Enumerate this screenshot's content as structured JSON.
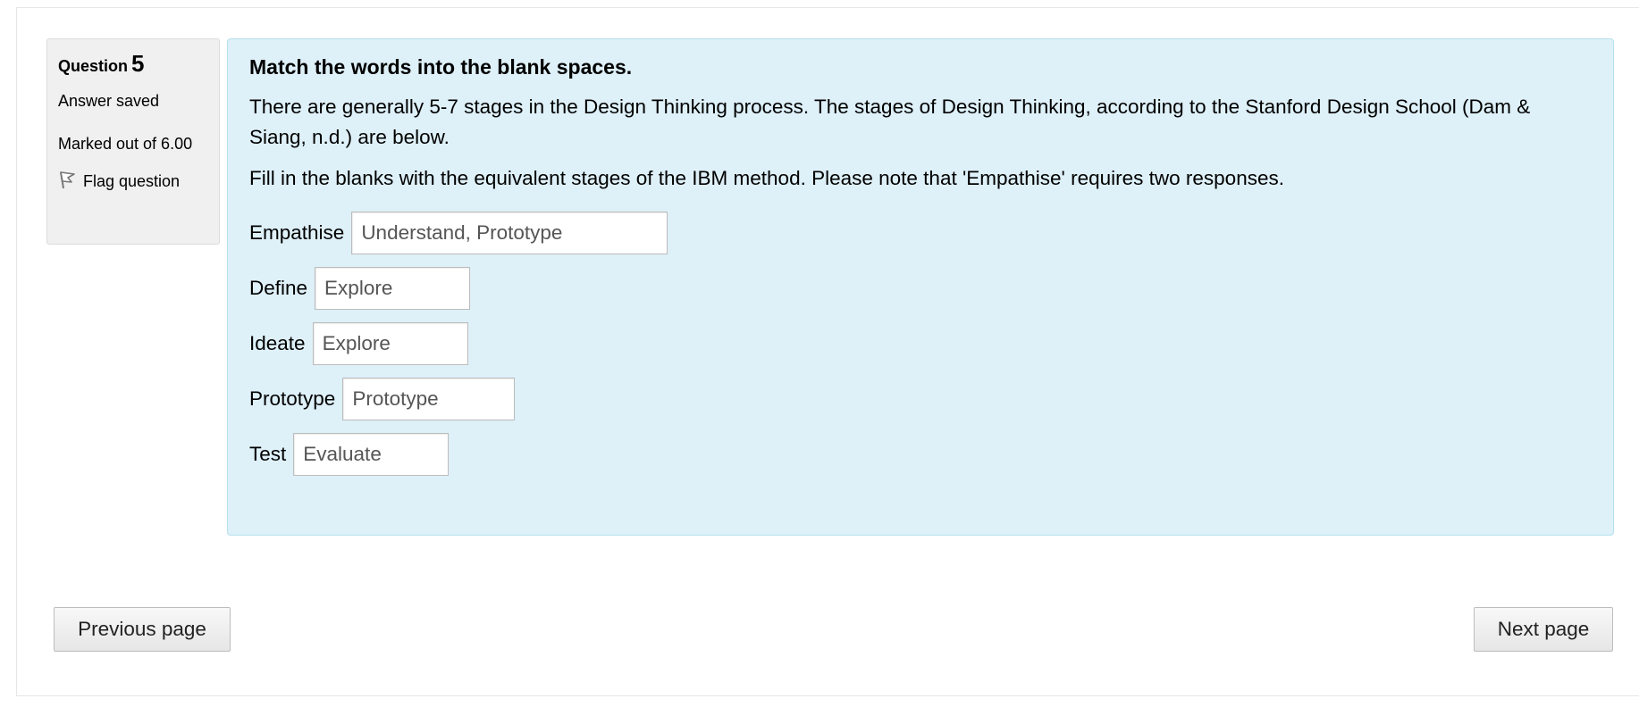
{
  "question_info": {
    "question_label": "Question",
    "question_number": "5",
    "state": "Answer saved",
    "marked_out_of": "Marked out of 6.00",
    "flag_label": "Flag question"
  },
  "content": {
    "instruction": "Match the words into the blank spaces.",
    "paragraph1": "There are generally 5-7 stages in the Design Thinking process. The stages of Design Thinking, according to the Stanford Design School (Dam & Siang, n.d.) are below.",
    "paragraph2": "Fill in the blanks with the equivalent stages of the IBM method. Please note that 'Empathise' requires two responses.",
    "blanks": [
      {
        "label": "Empathise",
        "value": "Understand, Prototype"
      },
      {
        "label": "Define",
        "value": "Explore"
      },
      {
        "label": "Ideate",
        "value": "Explore"
      },
      {
        "label": "Prototype",
        "value": "Prototype"
      },
      {
        "label": "Test",
        "value": "Evaluate"
      }
    ]
  },
  "navigation": {
    "previous_label": "Previous page",
    "next_label": "Next page"
  },
  "icons": {
    "flag": "flag-icon"
  }
}
